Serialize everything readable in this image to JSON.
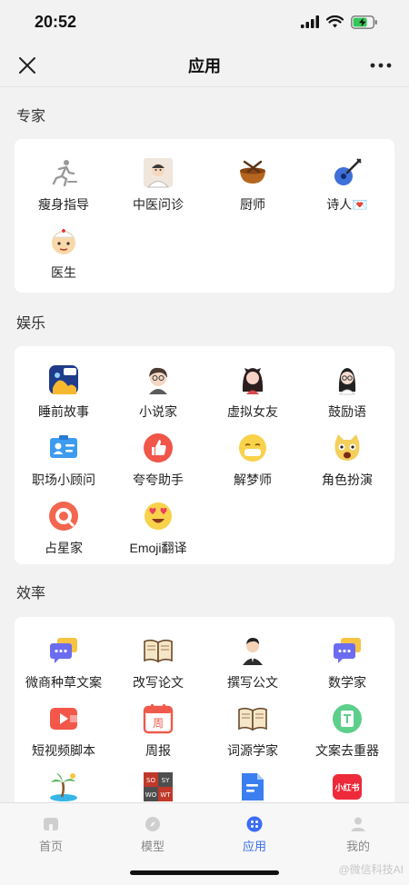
{
  "status_bar": {
    "time": "20:52"
  },
  "nav": {
    "title": "应用"
  },
  "sections": [
    {
      "title": "专家",
      "apps": [
        {
          "label": "瘦身指导",
          "icon": "running-icon"
        },
        {
          "label": "中医问诊",
          "icon": "doctor-portrait-icon"
        },
        {
          "label": "厨师",
          "icon": "cooking-pot-icon"
        },
        {
          "label": "诗人💌",
          "icon": "guitar-icon"
        },
        {
          "label": "医生",
          "icon": "nurse-face-icon"
        }
      ]
    },
    {
      "title": "娱乐",
      "apps": [
        {
          "label": "睡前故事",
          "icon": "storybook-icon"
        },
        {
          "label": "小说家",
          "icon": "novelist-portrait-icon"
        },
        {
          "label": "虚拟女友",
          "icon": "girlfriend-portrait-icon"
        },
        {
          "label": "鼓励语",
          "icon": "girl-portrait-icon"
        },
        {
          "label": "职场小顾问",
          "icon": "id-card-icon"
        },
        {
          "label": "夸夸助手",
          "icon": "thumbs-up-icon"
        },
        {
          "label": "解梦师",
          "icon": "sleepy-emoji-icon"
        },
        {
          "label": "角色扮演",
          "icon": "cat-face-icon"
        },
        {
          "label": "占星家",
          "icon": "astrology-icon"
        },
        {
          "label": "Emoji翻译",
          "icon": "heart-eyes-emoji-icon"
        }
      ]
    },
    {
      "title": "效率",
      "apps": [
        {
          "label": "微商种草文案",
          "icon": "chat-bubble-icon"
        },
        {
          "label": "改写论文",
          "icon": "open-book-icon"
        },
        {
          "label": "撰写公文",
          "icon": "man-portrait-icon"
        },
        {
          "label": "数学家",
          "icon": "chat-bubble-icon"
        },
        {
          "label": "短视频脚本",
          "icon": "video-play-icon"
        },
        {
          "label": "周报",
          "icon": "calendar-week-icon"
        },
        {
          "label": "词源学家",
          "icon": "open-book-icon"
        },
        {
          "label": "文案去重器",
          "icon": "document-copy-icon"
        },
        {
          "label": "",
          "icon": "palm-tree-icon"
        },
        {
          "label": "",
          "icon": "seo-grid-icon"
        },
        {
          "label": "",
          "icon": "document-blue-icon"
        },
        {
          "label": "",
          "icon": "xiaohongshu-icon"
        }
      ]
    }
  ],
  "tabs": [
    {
      "label": "首页",
      "icon": "home-icon"
    },
    {
      "label": "模型",
      "icon": "compass-icon"
    },
    {
      "label": "应用",
      "icon": "apps-icon",
      "active": true
    },
    {
      "label": "我的",
      "icon": "user-icon"
    }
  ],
  "seo_tiles": [
    "SO",
    "SY",
    "WO",
    "WT"
  ],
  "xhs_label": "小红书",
  "calendar_char": "周",
  "watermark": "@微信科技AI",
  "colors": {
    "accent": "#3b6cf5",
    "background": "#f2f2f2",
    "card": "#ffffff"
  }
}
